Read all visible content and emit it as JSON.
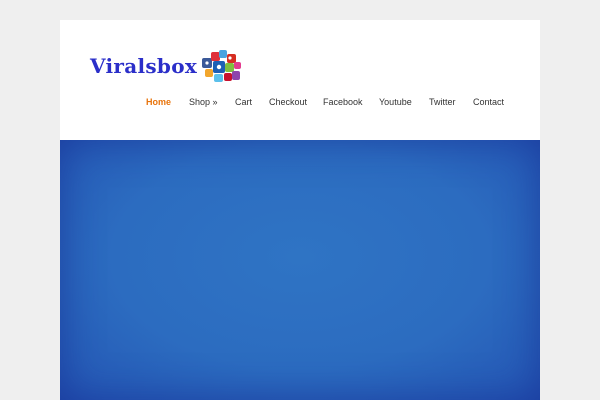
{
  "site": {
    "logo_text": "Viralsbox"
  },
  "nav": {
    "items": [
      {
        "label": "Home",
        "active": true
      },
      {
        "label": "Shop »",
        "active": false
      },
      {
        "label": "Cart",
        "active": false
      },
      {
        "label": "Checkout",
        "active": false
      },
      {
        "label": "Facebook",
        "active": false
      },
      {
        "label": "Youtube",
        "active": false
      },
      {
        "label": "Twitter",
        "active": false
      },
      {
        "label": "Contact",
        "active": false
      }
    ]
  },
  "colors": {
    "background": "#efefef",
    "logo": "#2b2fc9",
    "nav_active": "#e8740c",
    "nav_text": "#333333",
    "hero_blue": "#2c6cc0"
  },
  "icons": {
    "logo_art": "social-media-collage-icon"
  }
}
